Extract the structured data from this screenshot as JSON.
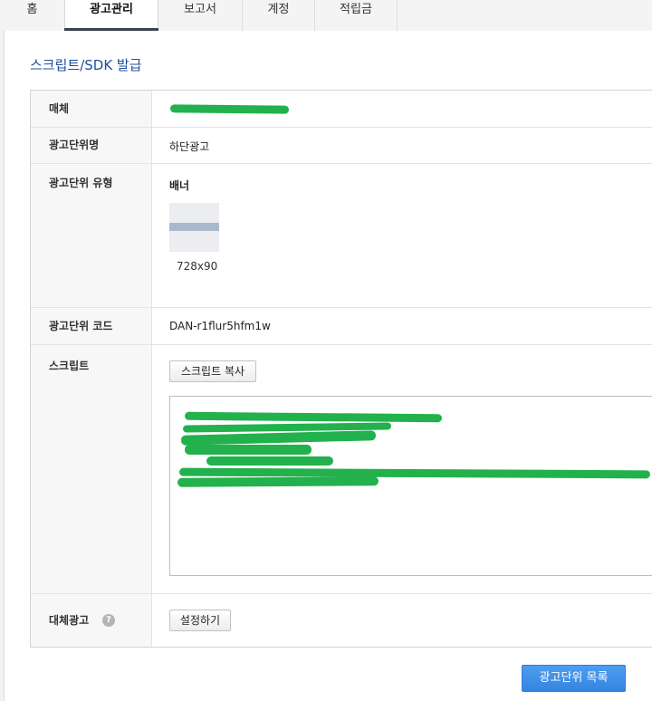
{
  "nav": {
    "tabs": [
      {
        "label": "홈"
      },
      {
        "label": "광고관리",
        "active": true
      },
      {
        "label": "보고서"
      },
      {
        "label": "계정"
      },
      {
        "label": "적립금"
      }
    ]
  },
  "page": {
    "title": "스크립트/SDK 발급"
  },
  "form": {
    "media": {
      "label": "매체"
    },
    "unit_name": {
      "label": "광고단위명",
      "value": "하단광고"
    },
    "unit_type": {
      "label": "광고단위 유형",
      "value": "배너",
      "size": "728x90"
    },
    "unit_code": {
      "label": "광고단위 코드",
      "value": "DAN-r1flur5hfm1w"
    },
    "script": {
      "label": "스크립트",
      "copy_button": "스크립트 복사"
    },
    "fallback": {
      "label": "대체광고",
      "help": "?",
      "setup_button": "설정하기"
    }
  },
  "footer": {
    "list_button": "광고단위 목록"
  },
  "colors": {
    "accent": "#1e4f9a",
    "primary_button": "#3a8ae6",
    "redaction": "#22b14c"
  }
}
